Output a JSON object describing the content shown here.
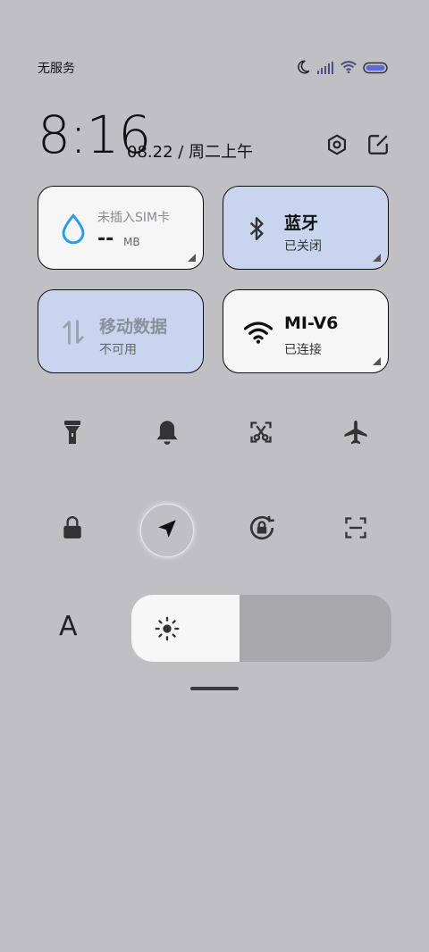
{
  "status_bar": {
    "carrier": "无服务",
    "icons": [
      "moon-icon",
      "signal-icon",
      "wifi-icon",
      "battery-icon"
    ]
  },
  "header": {
    "time": "8:16",
    "date": "08.22 / 周二上午",
    "settings_icon": "settings-icon",
    "edit_icon": "edit-icon"
  },
  "tiles": {
    "data_usage": {
      "title": "未插入SIM卡",
      "value": "--",
      "unit": "MB"
    },
    "bluetooth": {
      "title": "蓝牙",
      "status": "已关闭"
    },
    "mobile_data": {
      "title": "移动数据",
      "status": "不可用"
    },
    "wifi": {
      "title": "MI-V6",
      "status": "已连接"
    }
  },
  "quick_toggles": [
    "flashlight-icon",
    "bell-icon",
    "screenshot-icon",
    "airplane-icon",
    "lock-icon",
    "location-icon",
    "rotation-lock-icon",
    "scan-icon"
  ],
  "brightness": {
    "auto_label": "A",
    "level": 0.416
  },
  "colors": {
    "background": "#c0bfc4",
    "tile_white": "#f6f6f7",
    "tile_blue": "#c9d5ef",
    "accent_blue": "#2a9be8"
  }
}
